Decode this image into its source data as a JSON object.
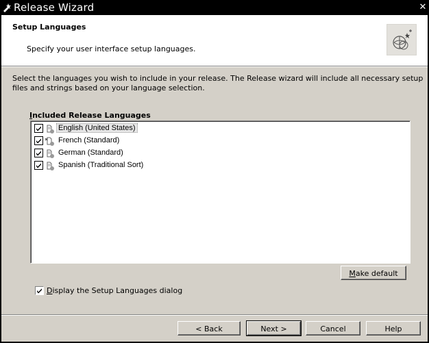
{
  "window": {
    "title": "Release Wizard",
    "close_glyph": "✕"
  },
  "header": {
    "title": "Setup Languages",
    "subtitle": "Specify your user interface setup languages."
  },
  "description": "Select the languages you wish to include in your release. The Release wizard will include all necessary setup files and strings based on your language selection.",
  "languages_group": {
    "label_prefix": "I",
    "label_rest": "ncluded Release Languages",
    "items": [
      {
        "label": "English (United States)",
        "checked": true,
        "selected": true
      },
      {
        "label": "French (Standard)",
        "checked": true,
        "selected": false
      },
      {
        "label": "German (Standard)",
        "checked": true,
        "selected": false
      },
      {
        "label": "Spanish (Traditional Sort)",
        "checked": true,
        "selected": false
      }
    ]
  },
  "make_default": {
    "accel": "M",
    "rest": "ake default"
  },
  "display_setup": {
    "accel": "D",
    "rest": "isplay the Setup Languages dialog",
    "checked": true
  },
  "buttons": {
    "back": "< Back",
    "next": "Next >",
    "cancel": "Cancel",
    "help": "Help"
  },
  "colors": {
    "titlebar": "#000000",
    "dialog": "#d4d0c8",
    "header": "#ffffff"
  }
}
